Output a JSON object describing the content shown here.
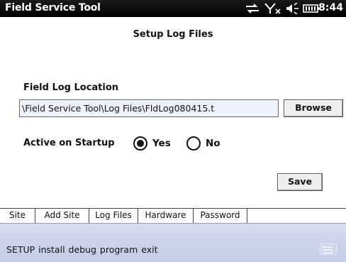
{
  "titlebar": {
    "app_title": "Field Service Tool",
    "clock": "8:44",
    "icons": [
      "data-sync-icon",
      "signal-off-icon",
      "speaker-icon",
      "battery-icon"
    ]
  },
  "page": {
    "heading": "Setup Log Files"
  },
  "field_log": {
    "label": "Field Log Location",
    "value": "\\Field Service Tool\\Log Files\\FldLog080415.t",
    "browse_label": "Browse"
  },
  "startup": {
    "label": "Active on Startup",
    "options": [
      {
        "label": "Yes",
        "selected": true
      },
      {
        "label": "No",
        "selected": false
      }
    ]
  },
  "save_label": "Save",
  "tabs": [
    {
      "label": "Site",
      "active": false
    },
    {
      "label": "Add Site",
      "active": false
    },
    {
      "label": "Log Files",
      "active": true
    },
    {
      "label": "Hardware",
      "active": false
    },
    {
      "label": "Password",
      "active": false
    }
  ],
  "menu": {
    "text": "SETUP install debug program exit"
  },
  "colors": {
    "titlebar": "#000000",
    "menu_bar": "#c9d0ea",
    "input_bg": "#eef2ff"
  }
}
